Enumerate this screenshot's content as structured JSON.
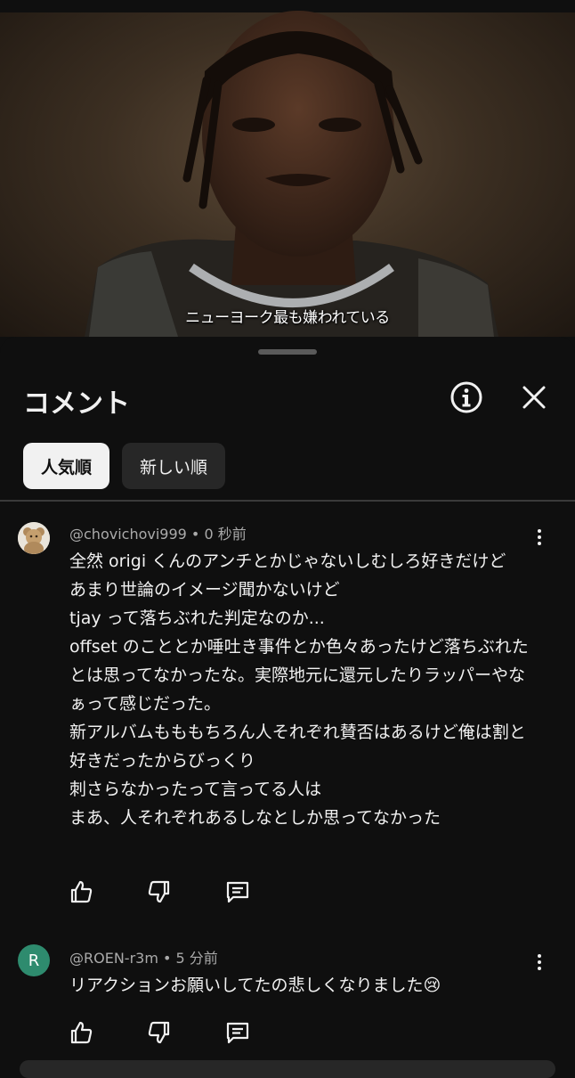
{
  "video": {
    "subtitle": "ニューヨーク最も嫌われている"
  },
  "sheet": {
    "title": "コメント",
    "chips": [
      {
        "label": "人気順",
        "active": true
      },
      {
        "label": "新しい順",
        "active": false
      }
    ]
  },
  "comments": [
    {
      "author": "@chovichovi999",
      "time": "0 秒前",
      "text": "全然 origi くんのアンチとかじゃないしむしろ好きだけど\nあまり世論のイメージ聞かないけど\ntjay って落ちぶれた判定なのか...\noffset のこととか唾吐き事件とか色々あったけど落ちぶれたとは思ってなかったな。実際地元に還元したりラッパーやなぁって感じだった。\n新アルバムもももちろん人それぞれ賛否はあるけど俺は割と好きだったからびっくり\n刺さらなかったって言ってる人は\nまあ、人それぞれあるしなとしか思ってなかった"
    },
    {
      "author": "@ROEN-r3m",
      "avatar_letter": "R",
      "time": "5 分前",
      "text": "リアクションお願いしてたの悲しくなりました😢"
    }
  ],
  "icons": [
    "info-icon",
    "close-icon",
    "more-vert-icon",
    "thumb-up-icon",
    "thumb-down-icon",
    "reply-icon"
  ]
}
